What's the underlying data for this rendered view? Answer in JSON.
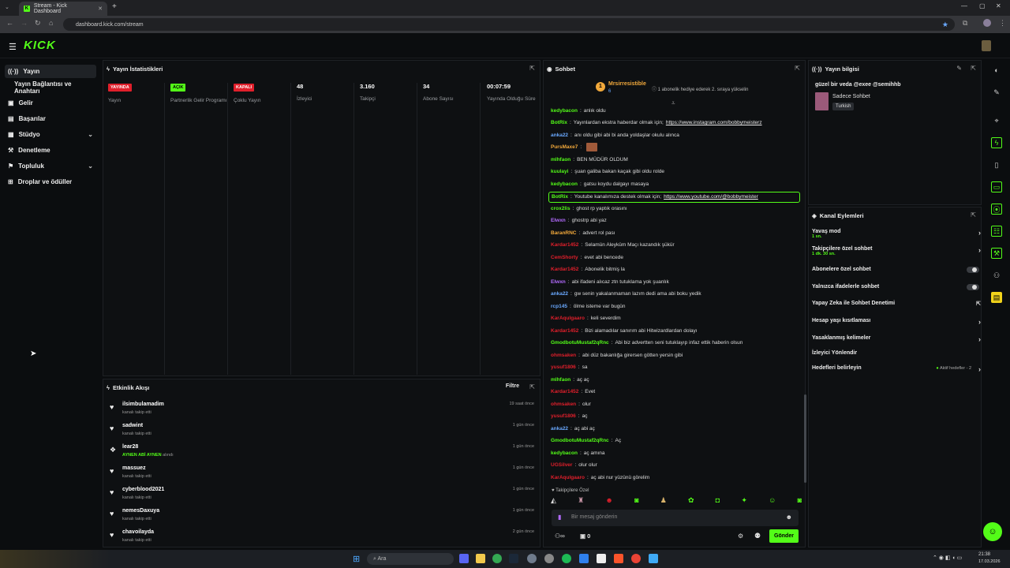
{
  "browser": {
    "tab_title": "Stream - Kick Dashboard",
    "url": "dashboard.kick.com/stream"
  },
  "app": {
    "logo": "KICK"
  },
  "sidebar": {
    "items": [
      {
        "label": "Yayın",
        "icon": "broadcast-icon"
      },
      {
        "label": "Yayın Bağlantısı ve Anahtarı",
        "icon": ""
      },
      {
        "label": "Gelir",
        "icon": "wallet-icon"
      },
      {
        "label": "Başarılar",
        "icon": "trophy-icon"
      },
      {
        "label": "Stüdyo",
        "icon": "studio-icon"
      },
      {
        "label": "Denetleme",
        "icon": "moderation-icon"
      },
      {
        "label": "Topluluk",
        "icon": "community-icon"
      },
      {
        "label": "Droplar ve ödüller",
        "icon": "gift-icon"
      }
    ]
  },
  "stats": {
    "title": "Yayın İstatistikleri",
    "items": [
      {
        "value": "YAYINDA",
        "label": "Yayın",
        "badge": "red"
      },
      {
        "value": "AÇIK",
        "label": "Partnerlik Gelir Programı",
        "badge": "green"
      },
      {
        "value": "KAPALI",
        "label": "Çoklu Yayın",
        "badge": "red"
      },
      {
        "value": "48",
        "label": "İzleyici"
      },
      {
        "value": "3.160",
        "label": "Takipçi"
      },
      {
        "value": "34",
        "label": "Abone Sayısı"
      },
      {
        "value": "00:07:59",
        "label": "Yayında Olduğu Süre"
      }
    ]
  },
  "events": {
    "title": "Etkinlik Akışı",
    "filter": "Filtre",
    "items": [
      {
        "user": "ilsimbulamadim",
        "sub": "kanalı takip etti",
        "time": "19 saat önce"
      },
      {
        "user": "sadwint",
        "sub": "kanalı takip etti",
        "time": "1 gün önce"
      },
      {
        "user": "lear28",
        "sub_highlight": "AYNEN ABİ AYNEN",
        "sub": "alındı",
        "time": "1 gün önce"
      },
      {
        "user": "massuez",
        "sub": "kanalı takip etti",
        "time": "1 gün önce"
      },
      {
        "user": "cyberblood2021",
        "sub": "kanalı takip etti",
        "time": "1 gün önce"
      },
      {
        "user": "nemesDaxuya",
        "sub": "kanalı takip etti",
        "time": "1 gün önce"
      },
      {
        "user": "chavoilayda",
        "sub": "kanalı takip etti",
        "time": "2 gün önce"
      }
    ]
  },
  "chat": {
    "title": "Sohbet",
    "pinned_user": "Mrsirresistible",
    "pinned_count": "6",
    "pinned_note": "1 abonelik hediye ederek 2. sıraya yükselin",
    "messages": [
      {
        "user": "kedybacon",
        "color": "#53fc18",
        "text": "anlık oldu"
      },
      {
        "user": "BotRix",
        "color": "#53fc18",
        "text": "Yayınlardan ekstra haberdar olmak için; ",
        "link": "https://www.instagram.com/bobbymeisterz"
      },
      {
        "user": "anka22",
        "color": "#6aa9ff",
        "text": "anı oldu gibi abi bi anda yoldaşlar okulu alınca"
      },
      {
        "user": "PursMaxe7",
        "color": "#f2a93b",
        "text": ""
      },
      {
        "user": "mlhfaon",
        "color": "#53fc18",
        "text": "BEN MÜDÜR OLDUM"
      },
      {
        "user": "kuulayi",
        "color": "#53fc18",
        "text": "şuan galiba bakan kaçak gibi oldu rolde"
      },
      {
        "user": "kedybacon",
        "color": "#53fc18",
        "text": "gatsu koydu dalgayı masaya"
      },
      {
        "user": "BotRix",
        "color": "#53fc18",
        "text": "Youtube kanalımıza destek olmak için; ",
        "link": "https://www.youtube.com/@bobbymeister"
      },
      {
        "user": "crox2lis",
        "color": "#53fc18",
        "text": "ghost rp yaptık orasını"
      },
      {
        "user": "Elwxn",
        "color": "#b36bff",
        "text": "ghostrp abi yaz"
      },
      {
        "user": "BaranRNC",
        "color": "#f2a93b",
        "text": "advert rol pası"
      },
      {
        "user": "Kardar1452",
        "color": "#e01f2b",
        "text": "Selamün Aleyküm Maçı kazandık şükür"
      },
      {
        "user": "CemShorty",
        "color": "#e01f2b",
        "text": "evet abi bencede"
      },
      {
        "user": "Kardar1452",
        "color": "#e01f2b",
        "text": "Abonelik bitmiş la"
      },
      {
        "user": "Elwxn",
        "color": "#b36bff",
        "text": "abi ifadeni alıcaz ztn tutuklama yok şuanlık"
      },
      {
        "user": "anka22",
        "color": "#6aa9ff",
        "text": "gw senin yakalanmaman lazım dedi ama abi boku yedik"
      },
      {
        "user": "rcp145",
        "color": "#6aa9ff",
        "text": "ölme isteme var bugün"
      },
      {
        "user": "KarAqulgaaro",
        "color": "#e01f2b",
        "text": "keli severdim"
      },
      {
        "user": "Kardar1452",
        "color": "#e01f2b",
        "text": "Bizi alamadılar sanırım abi Hitwizardlardan dolayı"
      },
      {
        "user": "GmodbotuMustaf2qRnc",
        "color": "#53fc18",
        "text": "Abi biz advertten seni tutuklayıp infaz ettik haberin olsun"
      },
      {
        "user": "ohmsaken",
        "color": "#e01f2b",
        "text": "abi düz bakanlığa girersen götten yersin gibi"
      },
      {
        "user": "yusuf1806",
        "color": "#e01f2b",
        "text": "sa"
      },
      {
        "user": "mlhfaon",
        "color": "#53fc18",
        "text": "aç aç"
      },
      {
        "user": "Kardar1452",
        "color": "#e01f2b",
        "text": "Evet"
      },
      {
        "user": "ohmsaken",
        "color": "#e01f2b",
        "text": "olur"
      },
      {
        "user": "yusuf1806",
        "color": "#e01f2b",
        "text": "aç"
      },
      {
        "user": "anka22",
        "color": "#6aa9ff",
        "text": "aç abi aç"
      },
      {
        "user": "GmodbotuMustaf2qRnc",
        "color": "#53fc18",
        "text": "Aç"
      },
      {
        "user": "kedybacon",
        "color": "#53fc18",
        "text": "aç amına"
      },
      {
        "user": "UGSilver",
        "color": "#e01f2b",
        "text": "olur olur"
      },
      {
        "user": "KarAqulgaaro",
        "color": "#e01f2b",
        "text": "aç abi nur yüzünü görelim"
      }
    ],
    "followers_only_label": "Takipçilere Özel",
    "input_placeholder": "Bir mesaj gönderin",
    "count_left": "∞",
    "count_right": "0",
    "send_label": "Gönder"
  },
  "stream_info": {
    "title": "Yayın bilgisi",
    "stream_title": "güzel bir veda @exee @semihhb",
    "category": "Sadece Sohbet",
    "language": "Turkish"
  },
  "channel_actions": {
    "title": "Kanal Eylemleri",
    "items": [
      {
        "label": "Yavaş mod",
        "sub": "1 sn.",
        "type": "chevron"
      },
      {
        "label": "Takipçilere özel sohbet",
        "sub": "1 dk. 30 sn.",
        "type": "chevron"
      },
      {
        "label": "Abonelere özel sohbet",
        "type": "toggle"
      },
      {
        "label": "Yalnızca ifadelerle sohbet",
        "type": "toggle"
      },
      {
        "label": "Yapay Zeka ile Sohbet Denetimi",
        "type": "external"
      },
      {
        "label": "Hesap yaşı kısıtlaması",
        "type": "chevron"
      },
      {
        "label": "Yasaklanmış kelimeler",
        "type": "chevron"
      },
      {
        "label": "İzleyici Yönlendir",
        "type": "none"
      },
      {
        "label": "Hedefleri belirleyin",
        "type": "chevron",
        "note": "Aktif hedefler - 2"
      }
    ]
  },
  "taskbar": {
    "search": "Ara",
    "time": "21:38",
    "date": "17.03.2026"
  },
  "colors": {
    "accent": "#53fc18",
    "live": "#e01f2b",
    "bg": "#0b0d0f"
  }
}
